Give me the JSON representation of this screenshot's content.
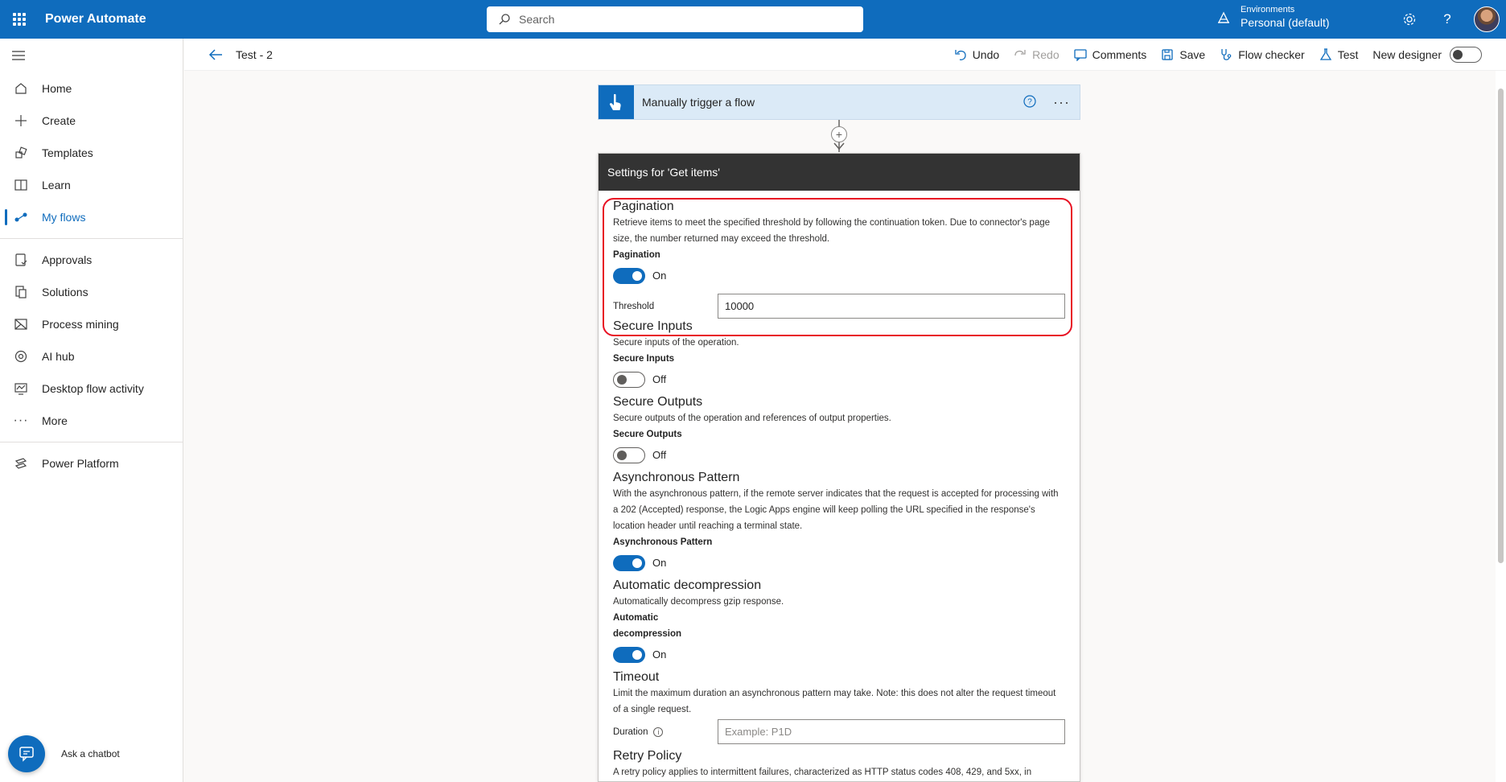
{
  "app": {
    "name": "Power Automate"
  },
  "search": {
    "placeholder": "Search"
  },
  "environment": {
    "label": "Environments",
    "name": "Personal (default)"
  },
  "sidebar": {
    "items": [
      {
        "label": "Home",
        "icon": "home-icon"
      },
      {
        "label": "Create",
        "icon": "plus-icon"
      },
      {
        "label": "Templates",
        "icon": "templates-icon"
      },
      {
        "label": "Learn",
        "icon": "book-icon"
      },
      {
        "label": "My flows",
        "icon": "flows-icon",
        "active": true
      },
      {
        "label": "Approvals",
        "icon": "approvals-icon"
      },
      {
        "label": "Solutions",
        "icon": "solutions-icon"
      },
      {
        "label": "Process mining",
        "icon": "process-mining-icon"
      },
      {
        "label": "AI hub",
        "icon": "ai-hub-icon"
      },
      {
        "label": "Desktop flow activity",
        "icon": "desktop-flow-icon"
      },
      {
        "label": "More",
        "icon": "more-icon"
      },
      {
        "label": "Power Platform",
        "icon": "power-platform-icon"
      }
    ],
    "chatbot_label": "Ask a chatbot"
  },
  "cmdbar": {
    "flow_title": "Test - 2",
    "undo": "Undo",
    "redo": "Redo",
    "comments": "Comments",
    "save": "Save",
    "flow_checker": "Flow checker",
    "test": "Test",
    "new_designer": "New designer"
  },
  "trigger": {
    "title": "Manually trigger a flow"
  },
  "panel": {
    "header": "Settings for 'Get items'",
    "pagination": {
      "title": "Pagination",
      "desc": "Retrieve items to meet the specified threshold by following the continuation token. Due to connector's page size, the number returned may exceed the threshold.",
      "label": "Pagination",
      "state": "On",
      "threshold_label": "Threshold",
      "threshold_value": "10000"
    },
    "secure_inputs": {
      "title": "Secure Inputs",
      "desc": "Secure inputs of the operation.",
      "label": "Secure Inputs",
      "state": "Off"
    },
    "secure_outputs": {
      "title": "Secure Outputs",
      "desc": "Secure outputs of the operation and references of output properties.",
      "label": "Secure Outputs",
      "state": "Off"
    },
    "async": {
      "title": "Asynchronous Pattern",
      "desc": "With the asynchronous pattern, if the remote server indicates that the request is accepted for processing with a 202 (Accepted) response, the Logic Apps engine will keep polling the URL specified in the response's location header until reaching a terminal state.",
      "label": "Asynchronous Pattern",
      "state": "On"
    },
    "decompression": {
      "title": "Automatic decompression",
      "desc": "Automatically decompress gzip response.",
      "label_line1": "Automatic",
      "label_line2": "decompression",
      "state": "On"
    },
    "timeout": {
      "title": "Timeout",
      "desc": "Limit the maximum duration an asynchronous pattern may take. Note: this does not alter the request timeout of a single request.",
      "duration_label": "Duration",
      "duration_placeholder": "Example: P1D"
    },
    "retry": {
      "title": "Retry Policy",
      "desc": "A retry policy applies to intermittent failures, characterized as HTTP status codes 408, 429, and 5xx, in"
    }
  },
  "colors": {
    "brand": "#0f6cbd",
    "highlight": "#e81123",
    "panel_header": "#333333"
  }
}
